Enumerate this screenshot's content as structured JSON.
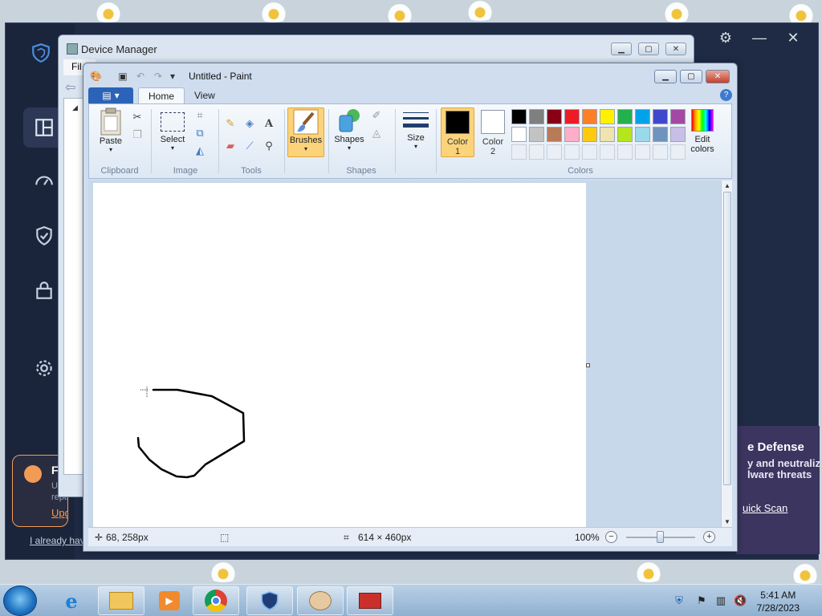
{
  "security_app": {
    "controls": {
      "settings": "settings",
      "minimize": "—",
      "close": "✕"
    },
    "promo": {
      "title": "F",
      "text_line1": "U",
      "text_line2": "repairs",
      "link": "Upgrad"
    },
    "already_link": "I already hav",
    "card": {
      "title": "e Defense",
      "line1": "y and neutralize",
      "line2": "lware threats",
      "link": "uick Scan"
    }
  },
  "device_manager": {
    "title": "Device Manager",
    "menu_file": "Fil"
  },
  "paint": {
    "title": "Untitled - Paint",
    "tabs": {
      "home": "Home",
      "view": "View"
    },
    "groups": {
      "clipboard": "Clipboard",
      "image": "Image",
      "tools": "Tools",
      "shapes": "Shapes",
      "colors": "Colors"
    },
    "buttons": {
      "paste": "Paste",
      "select": "Select",
      "brushes": "Brushes",
      "shapes": "Shapes",
      "size": "Size",
      "color1_a": "Color",
      "color1_b": "1",
      "color2_a": "Color",
      "color2_b": "2",
      "edit_a": "Edit",
      "edit_b": "colors"
    },
    "color1": "#000000",
    "color2": "#ffffff",
    "palette_row1": [
      "#000000",
      "#7f7f7f",
      "#880015",
      "#ed1c24",
      "#ff7f27",
      "#fff200",
      "#22b14c",
      "#00a2e8",
      "#3f48cc",
      "#a349a4"
    ],
    "palette_row2": [
      "#ffffff",
      "#c3c3c3",
      "#b97a57",
      "#ffaec9",
      "#ffc90e",
      "#efe4b0",
      "#b5e61d",
      "#99d9ea",
      "#7092be",
      "#c8bfe7"
    ],
    "status": {
      "cursor_pos": "68, 258px",
      "canvas_size": "614 × 460px",
      "zoom": "100%"
    }
  },
  "taskbar": {
    "time": "5:41 AM",
    "date": "7/28/2023"
  }
}
